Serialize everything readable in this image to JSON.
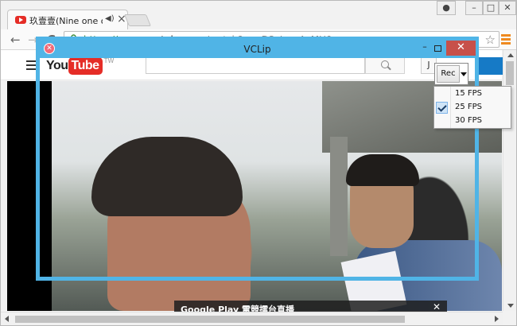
{
  "browser": {
    "tab_title": "玖壹壹(Nine one one)",
    "address_url_scheme": "https://",
    "address_url_host": "www.youtube.com",
    "address_url_path": "/watch?v=_D3sLm_AvMU0"
  },
  "youtube": {
    "logo_you": "You",
    "logo_tube": "Tube",
    "logo_region": "TW",
    "header_button": "J",
    "banner_text": "Google Play 電競擂台直播",
    "banner_close": "✕"
  },
  "vclip": {
    "title": "VCLip",
    "app_icon": "✕",
    "rec_label": "Rec",
    "fps_options": [
      "15 FPS",
      "25 FPS",
      "30 FPS"
    ],
    "fps_selected": "25 FPS"
  },
  "icons": {
    "minimize": "–",
    "close": "✕",
    "tab_close": "×",
    "speaker": "◀)",
    "back": "←",
    "forward": "→",
    "reload": "C",
    "star": "☆",
    "user": "●"
  },
  "colors": {
    "vclip_border": "#50b4e6",
    "youtube_red": "#e52d27",
    "window_close": "#c7504a",
    "url_green": "#2e7d32"
  }
}
